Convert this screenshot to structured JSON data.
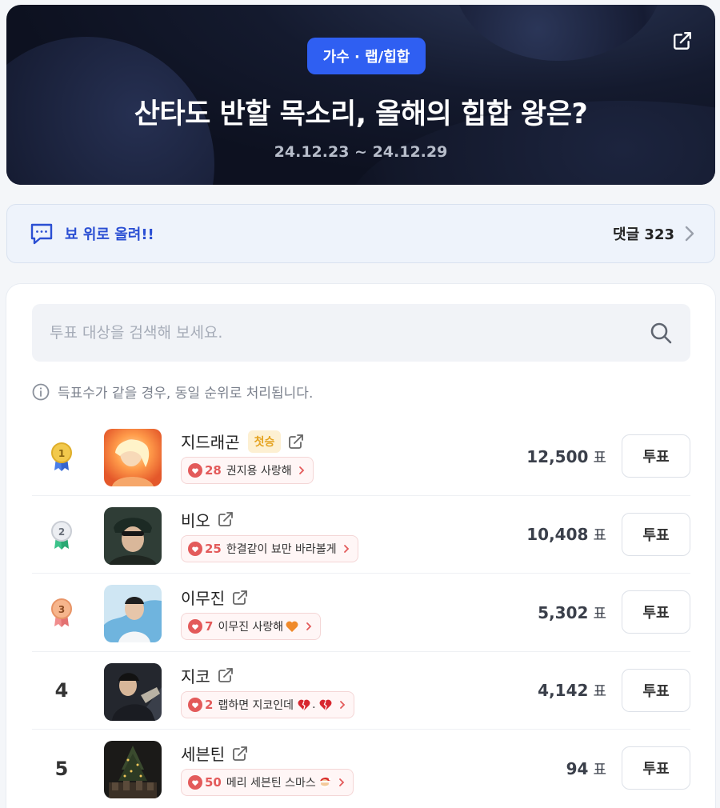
{
  "banner": {
    "category": "가수 · 랩/힙합",
    "title": "산타도 반할 목소리, 올해의 힙합 왕은?",
    "date_range": "24.12.23 ~ 24.12.29"
  },
  "comments": {
    "top_comment": "뵤 위로 올려!!",
    "count_label": "댓글 323"
  },
  "search": {
    "placeholder": "투표 대상을 검색해 보세요."
  },
  "notice": "득표수가 같을 경우, 동일 순위로 처리됩니다.",
  "vote_unit": "표",
  "vote_button_label": "투표",
  "first_win_badge": "첫승",
  "colors": {
    "accent": "#2f5ff2",
    "cheer": "#e35a5a",
    "gold": "#e7b93b",
    "silver": "#c9cdd4",
    "bronze": "#e89466"
  },
  "ranking": [
    {
      "rank": "1",
      "medal": "gold",
      "name": "지드래곤",
      "first_win": true,
      "cheer_count": "28",
      "cheer_text": "권지용 사랑해",
      "votes": "12,500"
    },
    {
      "rank": "2",
      "medal": "silver",
      "name": "비오",
      "first_win": false,
      "cheer_count": "25",
      "cheer_text": "한결같이 뵤만 바라볼게",
      "votes": "10,408"
    },
    {
      "rank": "3",
      "medal": "bronze",
      "name": "이무진",
      "first_win": false,
      "cheer_count": "7",
      "cheer_text": "이무진 사랑해",
      "cheer_emoji": "orange-heart",
      "votes": "5,302"
    },
    {
      "rank": "4",
      "medal": "",
      "name": "지코",
      "first_win": false,
      "cheer_count": "2",
      "cheer_text": "랩하면 지코인데",
      "cheer_emoji": "broken-hearts",
      "votes": "4,142"
    },
    {
      "rank": "5",
      "medal": "",
      "name": "세븐틴",
      "first_win": false,
      "cheer_count": "50",
      "cheer_text": "메리 세븐틴 스마스",
      "cheer_emoji": "santa-face",
      "votes": "94"
    }
  ]
}
